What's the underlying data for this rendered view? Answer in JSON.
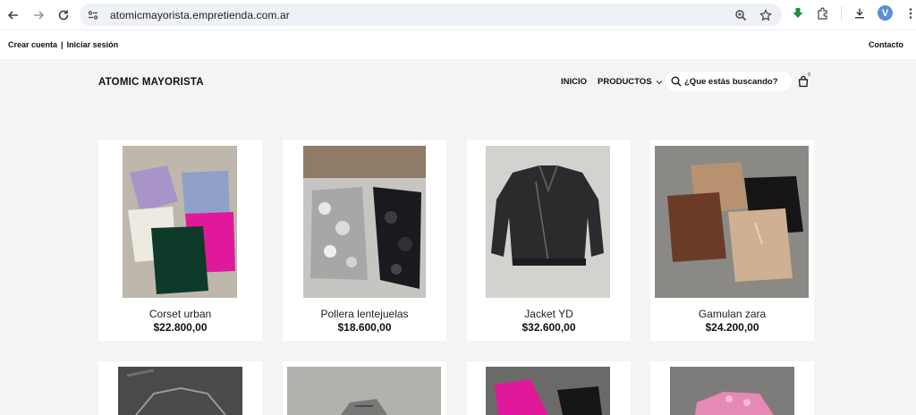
{
  "browser": {
    "url": "atomicmayorista.empretienda.com.ar",
    "profile_initial": "V"
  },
  "topbar": {
    "create_account": "Crear cuenta",
    "separator": "|",
    "login": "Iniciar sesión",
    "contact": "Contacto"
  },
  "header": {
    "brand": "ATOMIC MAYORISTA",
    "nav_home": "INICIO",
    "nav_products": "PRODUCTOS",
    "search_placeholder": "¿Que estás buscando?",
    "cart_count": "0"
  },
  "products": [
    {
      "name": "Corset urban",
      "price": "$22.800,00"
    },
    {
      "name": "Pollera lentejuelas",
      "price": "$18.600,00"
    },
    {
      "name": "Jacket YD",
      "price": "$32.600,00"
    },
    {
      "name": "Gamulan zara",
      "price": "$24.200,00"
    }
  ],
  "colors": {
    "page_bg": "#f4f4f4",
    "omnibox_bg": "#eef1f6",
    "extension_green": "#1e8e3e",
    "avatar_blue": "#5b8fd1"
  }
}
